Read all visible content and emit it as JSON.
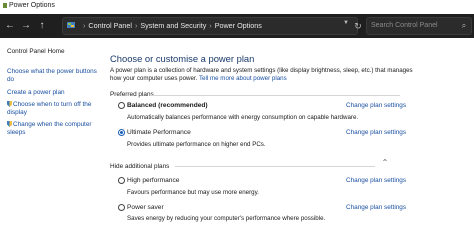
{
  "window": {
    "title": "Power Options"
  },
  "address_bar": {
    "breadcrumbs": [
      "Control Panel",
      "System and Security",
      "Power Options"
    ],
    "search_placeholder": "Search Control Panel",
    "icons": {
      "back": "arrow-left-icon",
      "forward": "arrow-right-icon",
      "up": "arrow-up-icon",
      "control_panel": "control-panel-icon",
      "dropdown": "chevron-down-icon",
      "refresh": "refresh-icon",
      "search": "search-icon"
    }
  },
  "sidebar": {
    "home": "Control Panel Home",
    "links": [
      "Choose what the power buttons do",
      "Create a power plan",
      "Choose when to turn off the display",
      "Change when the computer sleeps"
    ]
  },
  "main": {
    "title": "Choose or customise a power plan",
    "intro_text": "A power plan is a collection of hardware and system settings (like display brightness, sleep, etc.) that manages how your computer uses power. ",
    "intro_link": "Tell me more about power plans",
    "preferred_label": "Preferred plans",
    "hide_label": "Hide additional plans",
    "change_label": "Change plan settings",
    "plans": [
      {
        "name": "Balanced (recommended)",
        "desc": "Automatically balances performance with energy consumption on capable hardware.",
        "selected": false
      },
      {
        "name": "Ultimate Performance",
        "desc": "Provides ultimate performance on higher end PCs.",
        "selected": true
      },
      {
        "name": "High performance",
        "desc": "Favours performance but may use more energy.",
        "selected": false
      },
      {
        "name": "Power saver",
        "desc": "Saves energy by reducing your computer's performance where possible.",
        "selected": false
      }
    ]
  },
  "colors": {
    "link": "#1a4fa0",
    "title": "#1a3a6b",
    "address_bar_bg": "#1f1f1f",
    "radio_selected": "#1a5fb4"
  }
}
